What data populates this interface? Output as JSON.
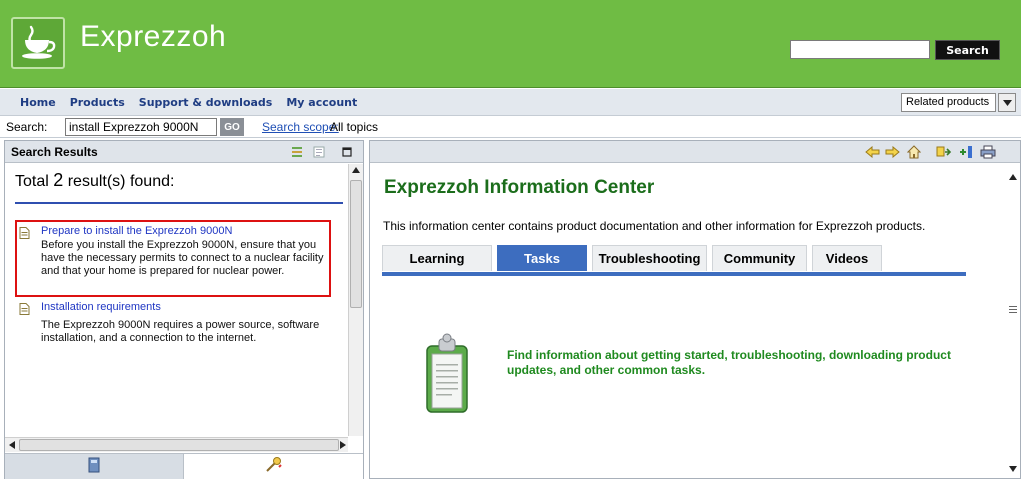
{
  "header": {
    "brand": "Exprezzoh",
    "search_placeholder": "",
    "search_button": "Search",
    "logo_icon": "coffee-cup-icon",
    "colors": {
      "bar": "#6fbc44",
      "button": "#111111"
    }
  },
  "nav": {
    "links": [
      {
        "label": "Home"
      },
      {
        "label": "Products"
      },
      {
        "label": "Support & downloads"
      },
      {
        "label": "My account"
      }
    ],
    "related_products": "Related products"
  },
  "search_bar": {
    "label": "Search:",
    "value": "install Exprezzoh 9000N",
    "go_label": "GO",
    "scope_link": "Search scope:",
    "scope_value": "All topics"
  },
  "left_panel": {
    "title": "Search Results",
    "total_prefix": "Total",
    "total_count": "2",
    "total_suffix": "result(s) found:",
    "results": [
      {
        "title": "Prepare to install the Exprezzoh 9000N",
        "description": "Before you install the Exprezzoh 9000N, ensure that you have the necessary permits to connect to a nuclear facility and that your home is prepared for nuclear power.",
        "highlighted": true
      },
      {
        "title": "Installation requirements",
        "description": "The Exprezzoh 9000N requires a power source, software installation, and a connection to the internet.",
        "highlighted": false
      }
    ],
    "bottom_tabs": [
      {
        "icon": "contents-book-icon"
      },
      {
        "icon": "search-results-icon"
      }
    ]
  },
  "right_panel": {
    "toolbar_icons": [
      "back-arrow-icon",
      "forward-arrow-icon",
      "home-icon",
      "sync-toc-icon",
      "bookmark-icon",
      "print-icon"
    ],
    "title": "Exprezzoh Information Center",
    "description": "This information center contains product documentation and other information for Exprezzoh products.",
    "tabs": [
      {
        "label": "Learning",
        "active": false
      },
      {
        "label": "Tasks",
        "active": true
      },
      {
        "label": "Troubleshooting",
        "active": false
      },
      {
        "label": "Community",
        "active": false
      },
      {
        "label": "Videos",
        "active": false
      }
    ],
    "task_text": "Find information about getting started, troubleshooting, downloading product updates, and other common tasks.",
    "task_icon": "clipboard-icon",
    "colors": {
      "title": "#1b6d1b",
      "tab_active": "#3d6dbf",
      "task_text": "#1f8a1f"
    }
  }
}
